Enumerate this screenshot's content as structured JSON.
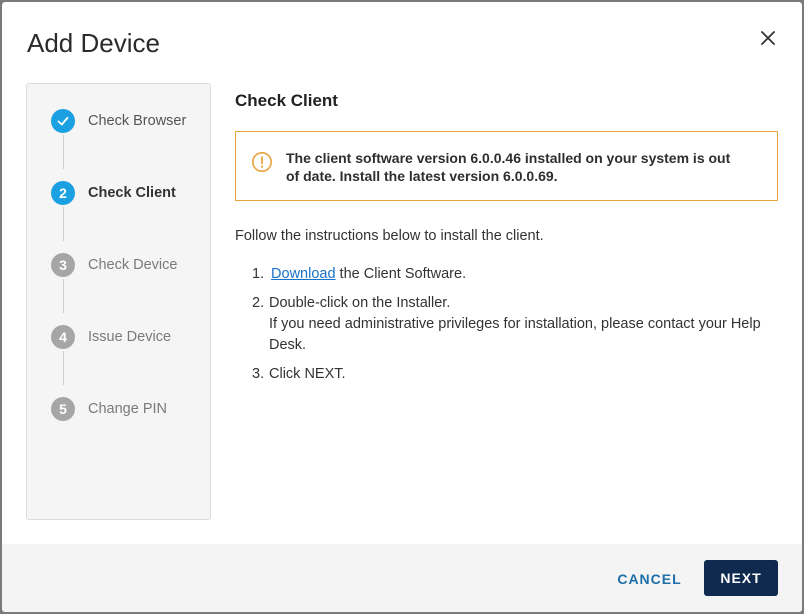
{
  "dialog": {
    "title": "Add Device",
    "close_icon": "close-icon"
  },
  "stepper": {
    "steps": [
      {
        "number": "1",
        "label": "Check Browser",
        "state": "completed",
        "icon": "checkmark-icon"
      },
      {
        "number": "2",
        "label": "Check Client",
        "state": "current"
      },
      {
        "number": "3",
        "label": "Check Device",
        "state": "pending"
      },
      {
        "number": "4",
        "label": "Issue Device",
        "state": "pending"
      },
      {
        "number": "5",
        "label": "Change PIN",
        "state": "pending"
      }
    ]
  },
  "content": {
    "title": "Check Client",
    "warning": {
      "icon": "warning-icon",
      "text": "The client software version 6.0.0.46 installed on your system is out of date. Install the latest version 6.0.0.69."
    },
    "intro": "Follow the instructions below to install the client.",
    "instructions": [
      {
        "number": "1.",
        "link": "Download",
        "text": " the Client Software."
      },
      {
        "number": "2.",
        "text": "Double-click on the Installer.",
        "subtext": "If you need administrative privileges for installation, please contact your Help Desk."
      },
      {
        "number": "3.",
        "text": "Click NEXT."
      }
    ]
  },
  "footer": {
    "cancel_label": "CANCEL",
    "next_label": "NEXT"
  },
  "colors": {
    "accent": "#1ba0e2",
    "warning": "#e8a33d",
    "primary_button": "#0f2a4e",
    "link": "#1a73c8"
  }
}
